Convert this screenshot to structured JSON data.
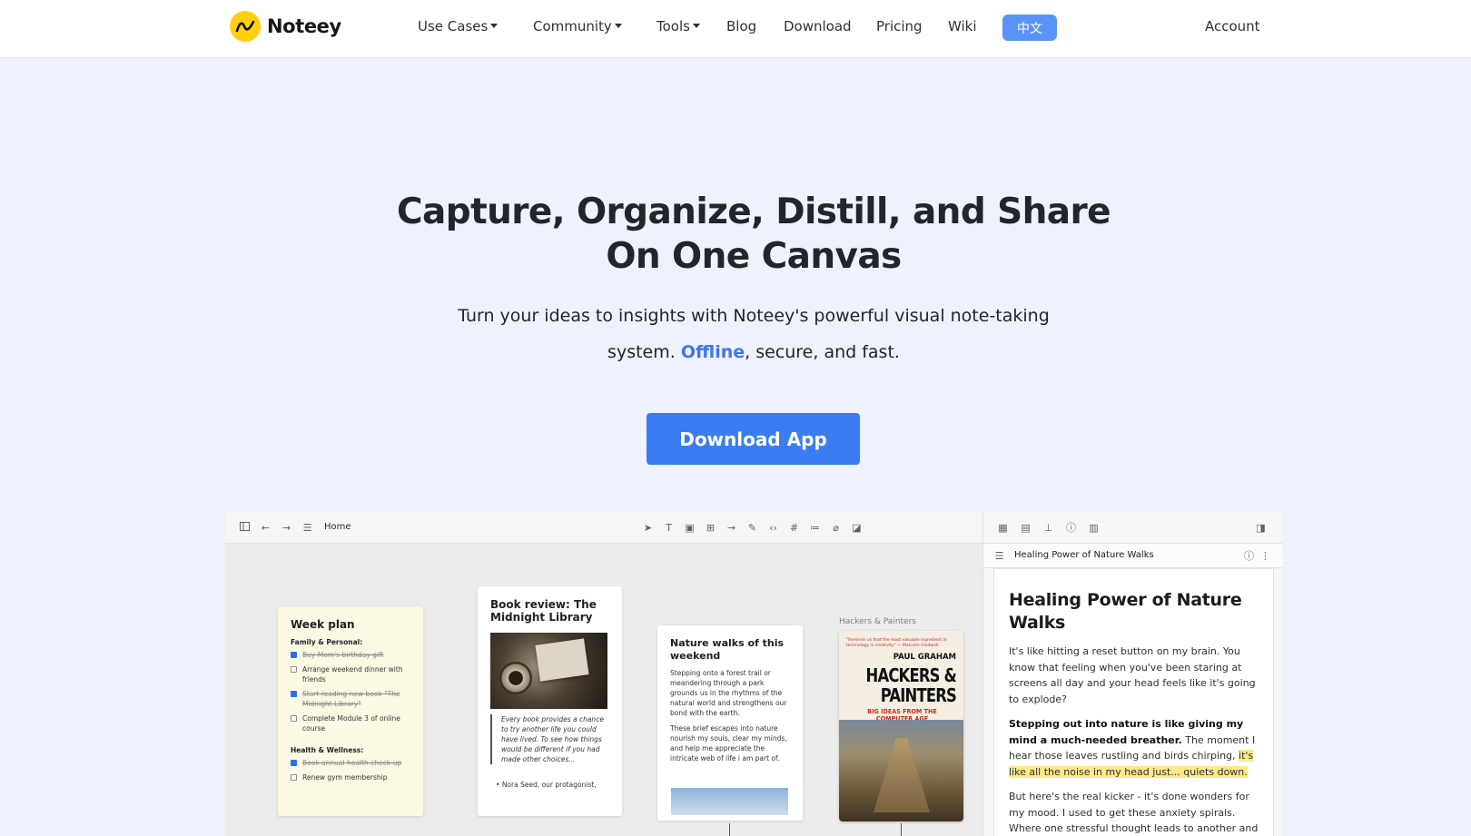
{
  "nav": {
    "brand": "Noteey",
    "items": [
      {
        "label": "Use Cases",
        "dropdown": true
      },
      {
        "label": "Community",
        "dropdown": true
      },
      {
        "label": "Tools",
        "dropdown": true
      },
      {
        "label": "Blog",
        "dropdown": false
      },
      {
        "label": "Download",
        "dropdown": false
      },
      {
        "label": "Pricing",
        "dropdown": false
      },
      {
        "label": "Wiki",
        "dropdown": false
      }
    ],
    "language_button": "中文",
    "account": "Account"
  },
  "hero": {
    "title_line1": "Capture, Organize, Distill, and Share",
    "title_line2": "On One Canvas",
    "subtitle_part1": "Turn your ideas to insights with Noteey's powerful visual note-taking system. ",
    "subtitle_accent": "Offline",
    "subtitle_part2": ", secure, and fast.",
    "cta_label": "Download App"
  },
  "app_preview": {
    "breadcrumb": "Home",
    "week_plan": {
      "title": "Week plan",
      "section1": "Family & Personal:",
      "items1": [
        {
          "text": "Buy Mom's birthday gift",
          "done": true
        },
        {
          "text": "Arrange weekend dinner with friends",
          "done": false
        },
        {
          "text": "Start reading new book \"The Midnight Library\"",
          "done": true
        },
        {
          "text": "Complete Module 3 of online course",
          "done": false
        }
      ],
      "section2": "Health & Wellness:",
      "items2": [
        {
          "text": "Book annual health check-up",
          "done": true
        },
        {
          "text": "Renew gym membership",
          "done": false
        }
      ]
    },
    "book_review": {
      "title": "Book review: The Midnight Library",
      "quote": "Every book provides a chance to try another life you could have lived. To see how things would be different if you had made other choices...",
      "bullet": "Nora Seed, our protagonist,"
    },
    "nature_card": {
      "title": "Nature walks of this weekend",
      "para1": "Stepping onto a forest trail or meandering through a park grounds us in the rhythms of the natural world and strengthens our bond with the earth.",
      "para2": "These brief escapes into nature nourish my souls, clear my minds, and help me appreciate the intricate web of life i am part of."
    },
    "book_cover": {
      "label": "Hackers & Painters",
      "blurb": "\"Reminds us that the most valuable ingredient in technology is creativity\" — Malcolm Gladwell",
      "author": "PAUL GRAHAM",
      "title": "HACKERS & PAINTERS",
      "subtitle": "BIG IDEAS FROM THE COMPUTER AGE"
    },
    "note": {
      "bar_title": "Healing Power of Nature Walks",
      "heading": "Healing Power of Nature Walks",
      "p1": "It's like hitting a reset button on my brain. You know that feeling when you've been staring at screens all day and your head feels like it's going to explode?",
      "p2_bold": "Stepping out into nature is like giving my mind a much-needed breather.",
      "p2_text": " The moment I hear those leaves rustling and birds chirping, ",
      "p2_highlight": "it's like all the noise in my head just... quiets down.",
      "p3": "But here's the real kicker - it's done wonders for my mood. I used to get these anxiety spirals. Where one stressful thought leads to another and"
    }
  },
  "colors": {
    "accent": "#3c7cf2",
    "brand_yellow": "#ffcf0f",
    "page_bg": "#edf2fc",
    "highlight": "#fde98a"
  },
  "icons": [
    "logo-mark-icon",
    "sidebar-toggle-icon",
    "back-arrow-icon",
    "forward-arrow-icon",
    "list-icon",
    "pointer-icon",
    "text-tool-icon",
    "image-tool-icon",
    "grid-tool-icon",
    "arrow-tool-icon",
    "pen-tool-icon",
    "code-tool-icon",
    "frame-tool-icon",
    "outline-tool-icon",
    "attachment-icon",
    "sticky-note-icon",
    "info-icon",
    "more-vertical-icon"
  ]
}
